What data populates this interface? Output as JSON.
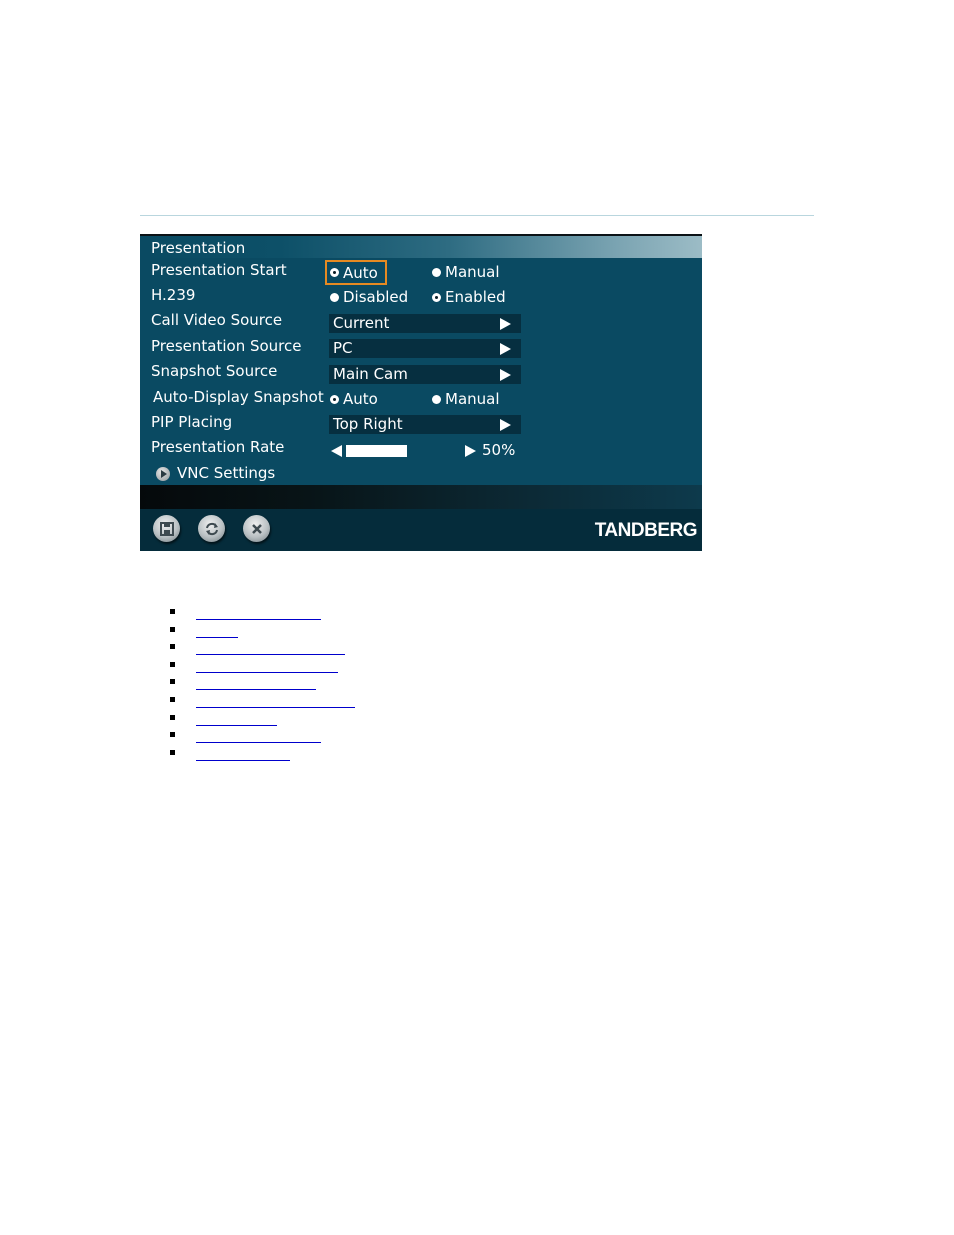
{
  "panel": {
    "title": "Presentation",
    "rows": [
      {
        "label": "Presentation Start",
        "type": "radio",
        "options": [
          "Auto",
          "Manual"
        ],
        "selected": "Auto",
        "focused": true
      },
      {
        "label": "H.239",
        "type": "radio",
        "options": [
          "Disabled",
          "Enabled"
        ],
        "selected": "Enabled"
      },
      {
        "label": "Call Video Source",
        "type": "select",
        "value": "Current"
      },
      {
        "label": "Presentation Source",
        "type": "select",
        "value": "PC"
      },
      {
        "label": "Snapshot Source",
        "type": "select",
        "value": "Main Cam"
      },
      {
        "label": "Auto-Display Snapshot",
        "type": "radio",
        "options": [
          "Auto",
          "Manual"
        ],
        "selected": "Auto"
      },
      {
        "label": "PIP Placing",
        "type": "select",
        "value": "Top Right"
      },
      {
        "label": "Presentation Rate",
        "type": "slider",
        "value_percent": 50,
        "value_text": "50%"
      }
    ],
    "submenu": {
      "label": "VNC Settings",
      "icon": "play-circle-icon"
    },
    "footer": {
      "buttons": [
        {
          "name": "save",
          "icon": "floppy-disk-icon"
        },
        {
          "name": "refresh",
          "icon": "refresh-icon"
        },
        {
          "name": "close",
          "icon": "close-x-icon"
        }
      ],
      "logo": "TANDBERG"
    },
    "colors": {
      "background": "#0a4a62",
      "focus": "#e58a22",
      "select_bg": "#062f40",
      "footer_bg": "#052c3b"
    }
  },
  "links": [
    "",
    "",
    "",
    "",
    "",
    "",
    "",
    "",
    ""
  ],
  "link_color": "#0000cc"
}
